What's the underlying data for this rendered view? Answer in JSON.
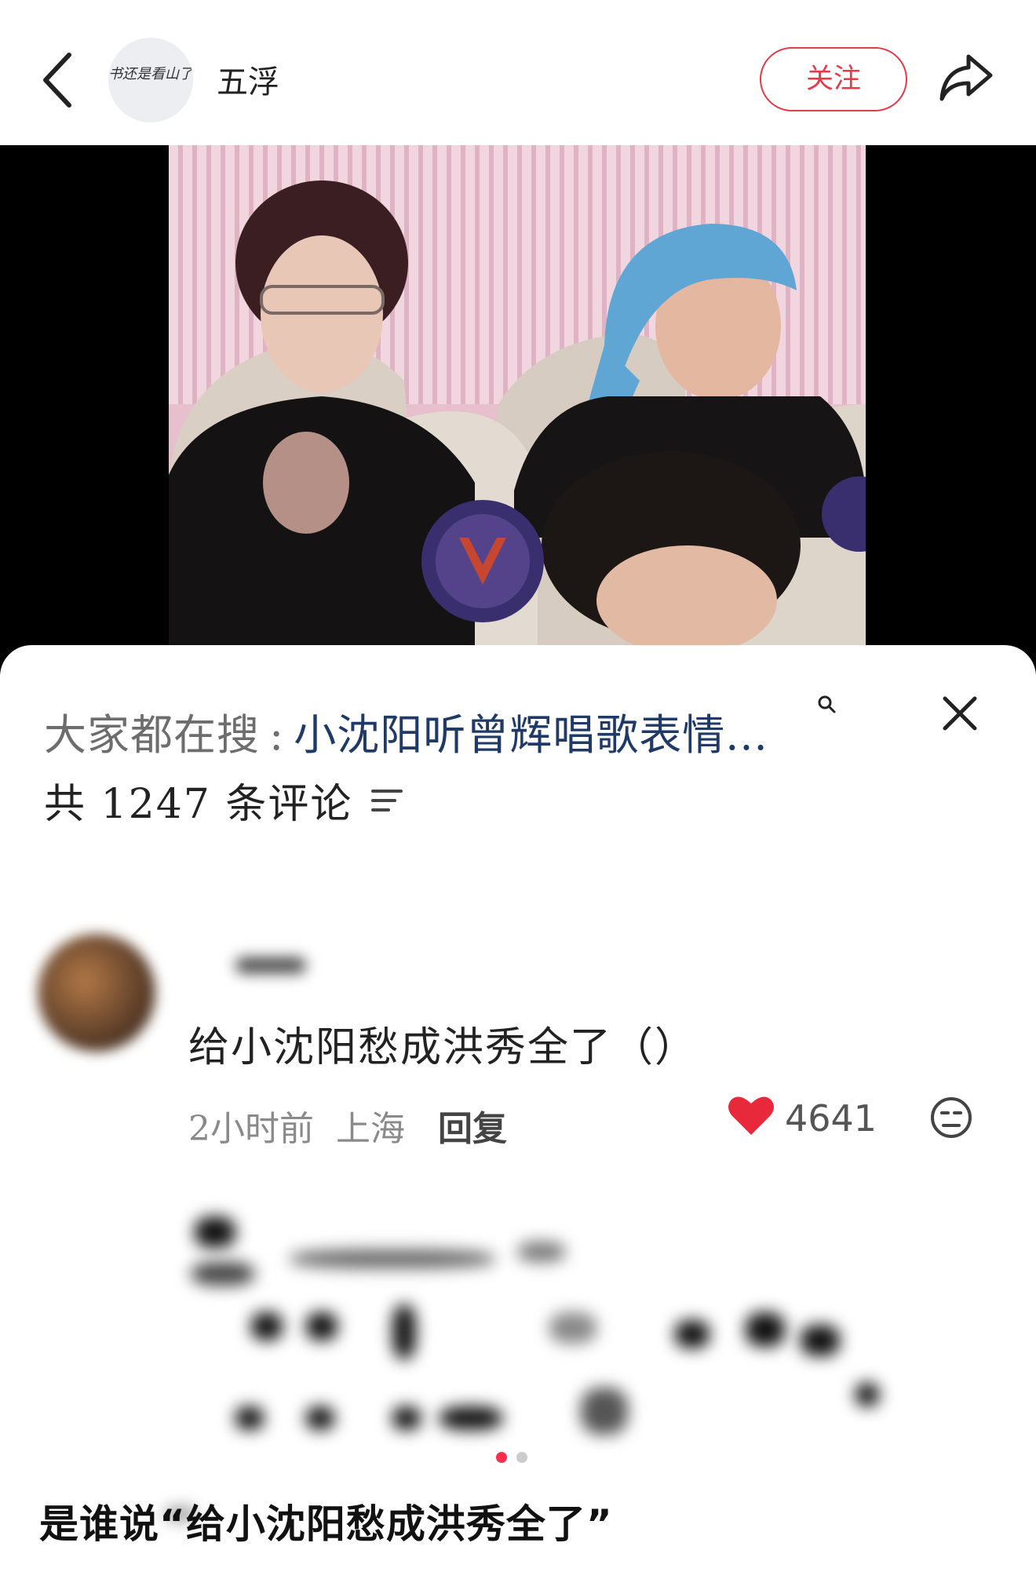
{
  "header": {
    "author_name": "五浮",
    "avatar_text": "书还是看山了",
    "follow_label": "关注"
  },
  "comments_panel": {
    "search_prefix": "大家都在搜",
    "search_separator": ":",
    "search_term": "小沈阳听曾辉唱歌表情...",
    "count_text": "共 1247 条评论"
  },
  "comment": {
    "text": "给小沈阳愁成洪秀全了（）",
    "time": "2小时前",
    "location": "上海",
    "reply_label": "回复",
    "likes": "4641"
  },
  "pager": {
    "count": 2,
    "active": 0
  },
  "caption": "是谁说“给小沈阳愁成洪秀全了”",
  "colors": {
    "accent": "#e53a4a",
    "search_term": "#1f3a66",
    "like_heart": "#e8293c",
    "dot_active": "#ff2e4d",
    "dot_inactive": "#cccccc"
  },
  "icons": [
    "back-arrow-icon",
    "share-icon",
    "close-icon",
    "search-icon",
    "filter-icon",
    "heart-icon",
    "emoji-icon"
  ]
}
